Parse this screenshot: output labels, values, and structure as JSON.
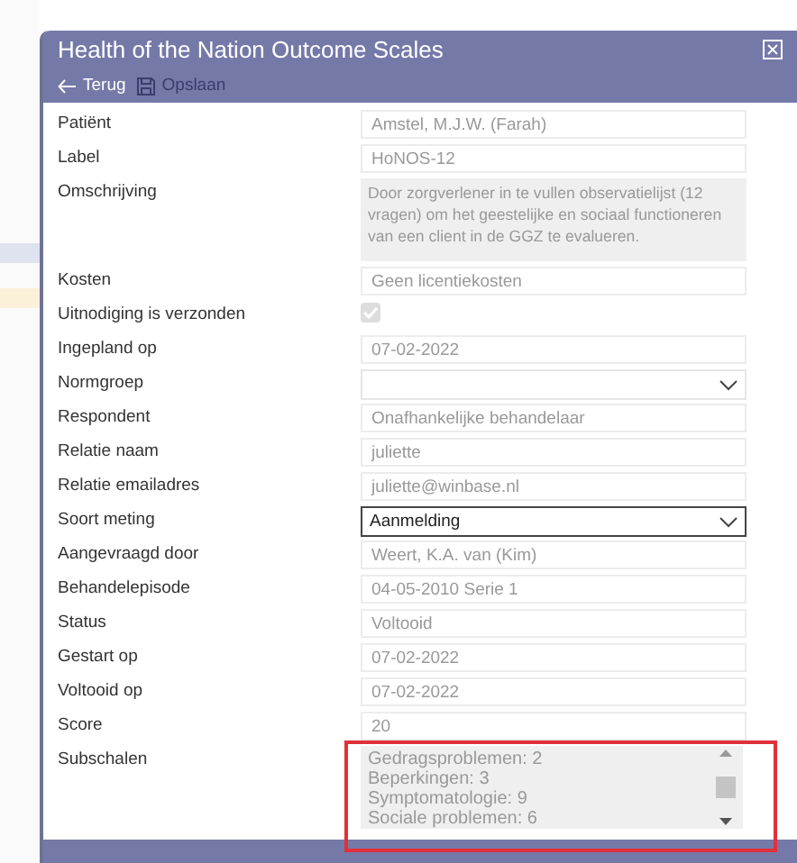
{
  "dialog": {
    "title": "Health of the Nation Outcome Scales",
    "toolbar": [
      {
        "kind": "back",
        "label": "Terug",
        "disabled": false
      },
      {
        "kind": "save",
        "label": "Opslaan",
        "disabled": true
      }
    ]
  },
  "fields": [
    {
      "label": "Patiënt",
      "kind": "text",
      "value": "Amstel, M.J.W. (Farah)"
    },
    {
      "label": "Label",
      "kind": "text",
      "value": "HoNOS-12"
    },
    {
      "label": "Omschrijving",
      "kind": "textarea",
      "value": "Door zorgverlener in te vullen observatielijst (12 vragen) om het geestelijke en sociaal functioneren van een client in de GGZ te evalueren."
    },
    {
      "label": "Kosten",
      "kind": "text",
      "value": "Geen licentiekosten"
    },
    {
      "label": "Uitnodiging is verzonden",
      "kind": "checkbox",
      "checked": true
    },
    {
      "label": "Ingepland op",
      "kind": "text",
      "value": "07-02-2022"
    },
    {
      "label": "Normgroep",
      "kind": "select"
    },
    {
      "label": "Respondent",
      "kind": "text",
      "value": "Onafhankelijke behandelaar"
    },
    {
      "label": "Relatie naam",
      "kind": "text",
      "value": "juliette"
    },
    {
      "label": "Relatie emailadres",
      "kind": "text",
      "value": "juliette@winbase.nl"
    },
    {
      "label": "Soort meting",
      "kind": "select",
      "value": "Aanmelding"
    },
    {
      "label": "Aangevraagd door",
      "kind": "text",
      "value": "Weert, K.A. van (Kim)"
    },
    {
      "label": "Behandelepisode",
      "kind": "text",
      "value": "04-05-2010 Serie 1"
    },
    {
      "label": "Status",
      "kind": "text",
      "value": "Voltooid"
    },
    {
      "label": "Gestart op",
      "kind": "text",
      "value": "07-02-2022"
    },
    {
      "label": "Voltooid op",
      "kind": "text",
      "value": "07-02-2022"
    },
    {
      "label": "Score",
      "kind": "text",
      "value": "20"
    },
    {
      "label": "Subschalen",
      "kind": "list",
      "items": [
        "Gedragsproblemen: 2",
        "Beperkingen: 3",
        "Symptomatologie: 9",
        "Sociale problemen: 6"
      ]
    }
  ]
}
